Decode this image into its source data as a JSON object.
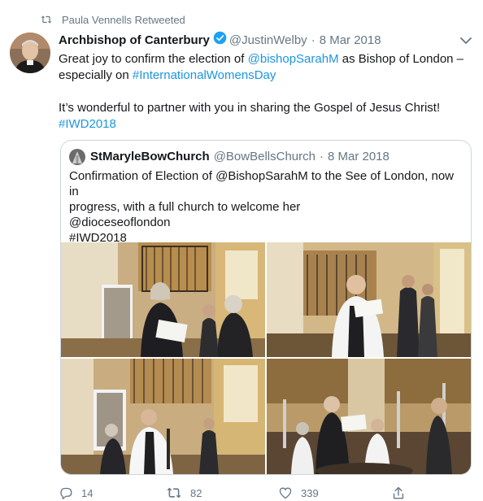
{
  "retweet_header": {
    "text": "Paula Vennells Retweeted"
  },
  "tweet": {
    "author_name": "Archbishop of Canterbury",
    "handle": "@JustinWelby",
    "separator": "·",
    "date": "8 Mar 2018",
    "text_part1": "Great joy to confirm the election of ",
    "mention": "@bishopSarahM",
    "text_part2": " as Bishop of London –",
    "text_part3": "especially on ",
    "hashtag1": "#InternationalWomensDay",
    "text_line2": "It’s wonderful to partner with you in sharing the Gospel of Jesus Christ!",
    "hashtag2": "#IWD2018"
  },
  "quoted": {
    "author_name": "StMaryleBowChurch",
    "handle": "@BowBellsChurch",
    "separator": "·",
    "date": "8 Mar 2018",
    "line1": "Confirmation of Election of @BishopSarahM to the See of London, now in",
    "line2": "progress, with a full church to welcome her",
    "line3": "@dioceseoflondon",
    "line4": "#IWD2018"
  },
  "actions": {
    "replies": "14",
    "retweets": "82",
    "likes": "339"
  },
  "colors": {
    "link": "#1b95e0",
    "muted": "#657786",
    "verified": "#1da1f2",
    "border": "#ccd6dd"
  },
  "icons": [
    "retweet-icon",
    "chevron-down-icon",
    "verified-badge-icon",
    "reply-icon",
    "like-icon",
    "share-icon"
  ]
}
